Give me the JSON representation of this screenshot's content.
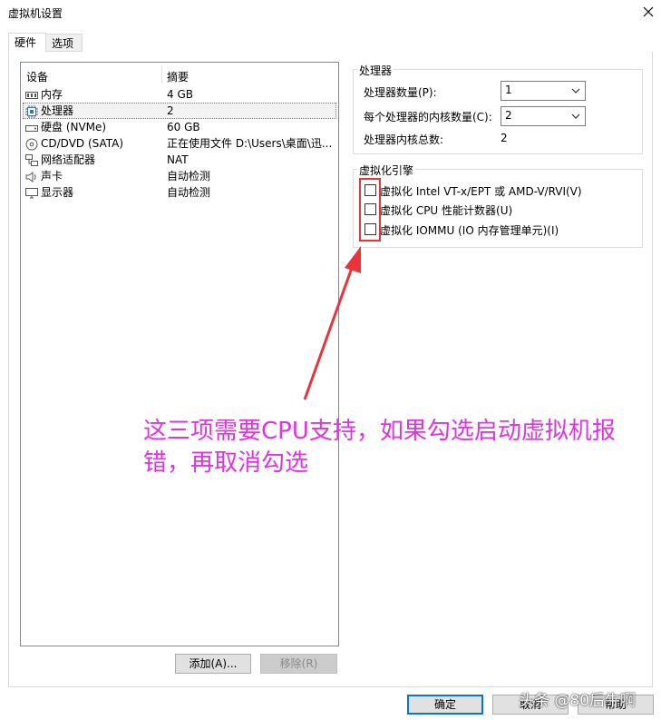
{
  "window": {
    "title": "虚拟机设置"
  },
  "tabs": [
    {
      "label": "硬件"
    },
    {
      "label": "选项"
    }
  ],
  "device_list": {
    "headers": {
      "device": "设备",
      "summary": "摘要"
    },
    "rows": [
      {
        "icon": "memory-icon",
        "name": "内存",
        "summary": "4 GB"
      },
      {
        "icon": "processor-icon",
        "name": "处理器",
        "summary": "2",
        "selected": true
      },
      {
        "icon": "hard-disk-icon",
        "name": "硬盘 (NVMe)",
        "summary": "60 GB"
      },
      {
        "icon": "cd-dvd-icon",
        "name": "CD/DVD (SATA)",
        "summary": "正在使用文件 D:\\Users\\桌面\\迅..."
      },
      {
        "icon": "network-adapter-icon",
        "name": "网络适配器",
        "summary": "NAT"
      },
      {
        "icon": "sound-card-icon",
        "name": "声卡",
        "summary": "自动检测"
      },
      {
        "icon": "display-icon",
        "name": "显示器",
        "summary": "自动检测"
      }
    ],
    "add_button": "添加(A)...",
    "remove_button": "移除(R)"
  },
  "processors": {
    "legend": "处理器",
    "count_label": "处理器数量(P):",
    "count_value": "1",
    "cores_label": "每个处理器的内核数量(C):",
    "cores_value": "2",
    "total_label": "处理器内核总数:",
    "total_value": "2"
  },
  "virtualization": {
    "legend": "虚拟化引擎",
    "options": [
      {
        "label": "虚拟化 Intel VT-x/EPT 或 AMD-V/RVI(V)",
        "checked": false
      },
      {
        "label": "虚拟化 CPU 性能计数器(U)",
        "checked": false
      },
      {
        "label": "虚拟化 IOMMU (IO 内存管理单元)(I)",
        "checked": false
      }
    ]
  },
  "annotation": {
    "text": "这三项需要CPU支持，如果勾选启动虚拟机报错，再取消勾选",
    "color": "#e332e3",
    "arrow_color": "#e8343a"
  },
  "footer": {
    "ok": "确定",
    "cancel": "取消",
    "help": "帮助"
  },
  "watermark": "头条 @80后牛啊"
}
